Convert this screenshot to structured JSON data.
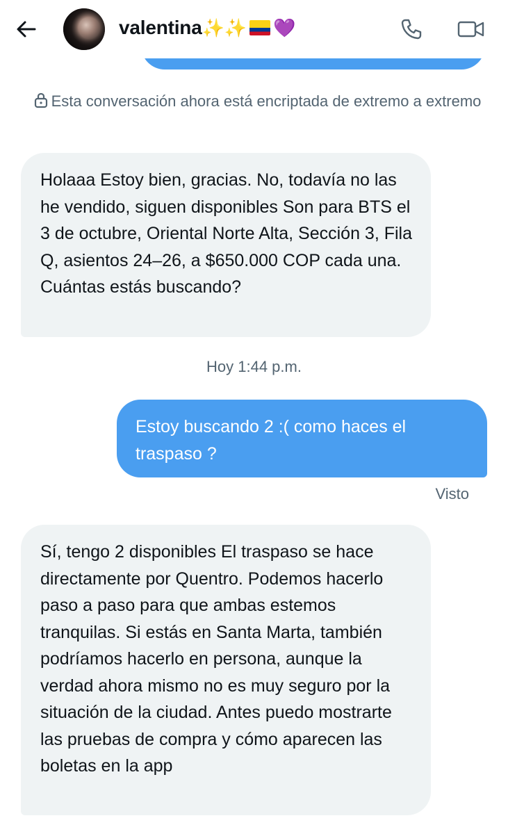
{
  "header": {
    "contact_name": "valentina",
    "name_emoji_1": "✨",
    "name_emoji_2": "✨",
    "name_emoji_heart": "💜",
    "icons": [
      "back-arrow-icon",
      "phone-icon",
      "video-icon"
    ]
  },
  "encryption_notice": "Esta conversación ahora está encriptada de extremo a extremo",
  "messages": [
    {
      "direction": "received",
      "text": "Holaaa Estoy bien, gracias. No, todavía no las he vendido, siguen disponibles Son para BTS el 3 de octubre, Oriental Norte Alta, Sección 3, Fila Q, asientos 24–26, a $650.000 COP cada una. Cuántas estás buscando?"
    },
    {
      "direction": "sent",
      "text": "Estoy buscando 2 :( como haces el traspaso ?"
    },
    {
      "direction": "received",
      "text": "Sí, tengo 2 disponibles El traspaso se hace directamente por Quentro. Podemos hacerlo paso a paso para que ambas estemos tranquilas. Si estás en Santa Marta, también podríamos hacerlo en persona, aunque la verdad ahora mismo no es muy seguro por la situación de la ciudad. Antes puedo mostrarte las pruebas de compra y cómo aparecen las boletas en la app"
    }
  ],
  "timestamp": "Hoy 1:44 p.m.",
  "seen_label": "Visto",
  "colors": {
    "sent_bubble": "#4a9ef0",
    "received_bubble": "#eff3f4",
    "secondary_text": "#536471"
  }
}
